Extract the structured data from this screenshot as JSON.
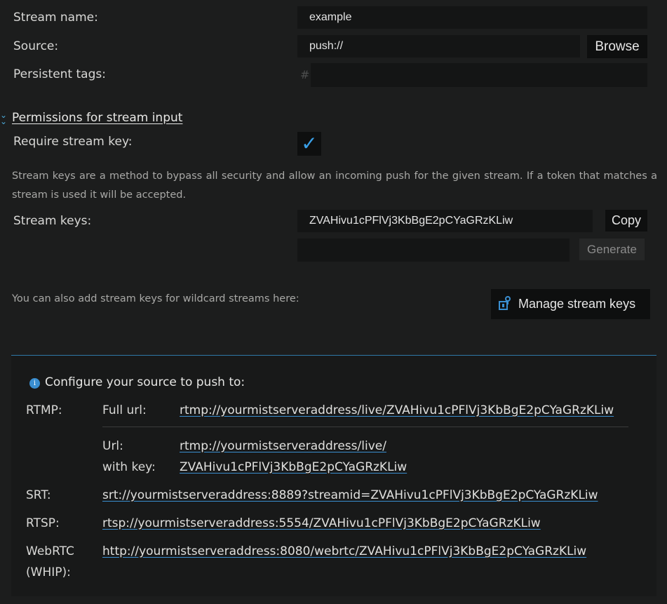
{
  "form": {
    "stream_name_label": "Stream name:",
    "stream_name_value": "example",
    "source_label": "Source:",
    "source_value": "push://",
    "browse_button": "Browse",
    "tags_label": "Persistent tags:",
    "tags_hash": "#"
  },
  "permissions": {
    "title": "Permissions for stream input",
    "require_key_label": "Require stream key:",
    "require_key_checked": "✓",
    "description": "Stream keys are a method to bypass all security and allow an incoming push for the given stream. If a token that matches a stream is used it will be accepted.",
    "stream_keys_label": "Stream keys:",
    "stream_key_value": "ZVAHivu1cPFlVj3KbBgE2pCYaGRzKLiw",
    "copy_button": "Copy",
    "generate_button": "Generate",
    "wildcard_text": "You can also add stream keys for wildcard streams here:",
    "manage_button": "Manage stream keys"
  },
  "push_info": {
    "heading": "Configure your source to push to:",
    "info_icon": "i",
    "rtmp_label": "RTMP:",
    "full_url_label": "Full url:",
    "full_url": "rtmp://yourmistserveraddress/live/ZVAHivu1cPFlVj3KbBgE2pCYaGRzKLiw",
    "url_label": "Url:",
    "url": "rtmp://yourmistserveraddress/live/",
    "with_key_label": "with key:",
    "key": "ZVAHivu1cPFlVj3KbBgE2pCYaGRzKLiw",
    "srt_label": "SRT:",
    "srt_url": "srt://yourmistserveraddress:8889?streamid=ZVAHivu1cPFlVj3KbBgE2pCYaGRzKLiw",
    "rtsp_label": "RTSP:",
    "rtsp_url": "rtsp://yourmistserveraddress:5554/ZVAHivu1cPFlVj3KbBgE2pCYaGRzKLiw",
    "webrtc_label_1": "WebRTC",
    "webrtc_label_2": "(WHIP):",
    "webrtc_url": "http://yourmistserveraddress:8080/webrtc/ZVAHivu1cPFlVj3KbBgE2pCYaGRzKLiw"
  }
}
